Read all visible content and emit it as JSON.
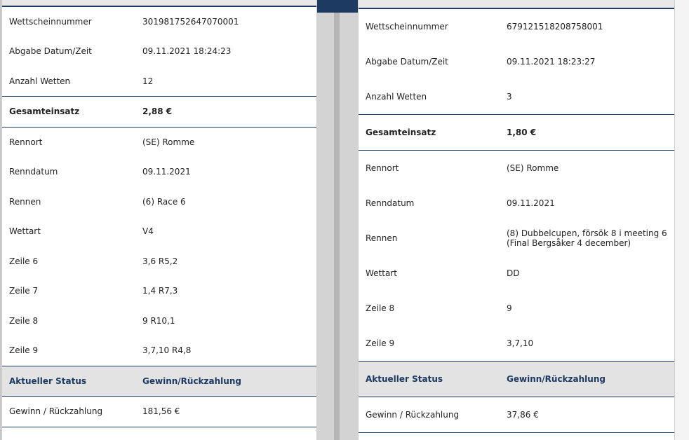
{
  "left": {
    "general": [
      {
        "label": "Wettscheinnummer",
        "value": "301981752647070001"
      },
      {
        "label": "Abgabe Datum/Zeit",
        "value": "09.11.2021 18:24:23"
      },
      {
        "label": "Anzahl Wetten",
        "value": "12"
      }
    ],
    "total": {
      "label": "Gesamteinsatz",
      "value": "2,88 €"
    },
    "race": [
      {
        "label": "Rennort",
        "value": "(SE) Romme"
      },
      {
        "label": "Renndatum",
        "value": "09.11.2021"
      },
      {
        "label": "Rennen",
        "value": "(6) Race 6"
      },
      {
        "label": "Wettart",
        "value": "V4"
      },
      {
        "label": "Zeile 6",
        "value": "3,6 R5,2"
      },
      {
        "label": "Zeile 7",
        "value": "1,4 R7,3"
      },
      {
        "label": "Zeile 8",
        "value": "9 R10,1"
      },
      {
        "label": "Zeile 9",
        "value": "3,7,10 R4,8"
      }
    ],
    "status": {
      "label": "Aktueller Status",
      "value": "Gewinn/Rückzahlung"
    },
    "payout": {
      "label": "Gewinn / Rückzahlung",
      "value": "181,56 €"
    }
  },
  "right": {
    "general": [
      {
        "label": "Wettscheinnummer",
        "value": "679121518208758001"
      },
      {
        "label": "Abgabe Datum/Zeit",
        "value": "09.11.2021 18:23:27"
      },
      {
        "label": "Anzahl Wetten",
        "value": "3"
      }
    ],
    "total": {
      "label": "Gesamteinsatz",
      "value": "1,80 €"
    },
    "race": [
      {
        "label": "Rennort",
        "value": "(SE) Romme"
      },
      {
        "label": "Renndatum",
        "value": "09.11.2021"
      },
      {
        "label": "Rennen",
        "value_line1": "(8) Dubbelcupen, försök 8 i meeting 6",
        "value_line2": "(Final Bergsåker 4 december)"
      },
      {
        "label": "Wettart",
        "value": "DD"
      },
      {
        "label": "Zeile 8",
        "value": "9"
      },
      {
        "label": "Zeile 9",
        "value": "3,7,10"
      }
    ],
    "status": {
      "label": "Aktueller Status",
      "value": "Gewinn/Rückzahlung"
    },
    "payout": {
      "label": "Gewinn / Rückzahlung",
      "value": "37,86 €"
    }
  }
}
